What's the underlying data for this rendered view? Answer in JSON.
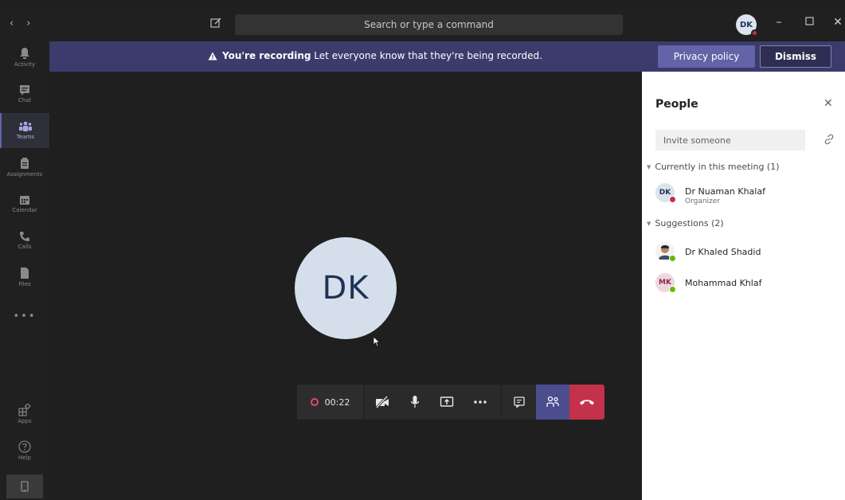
{
  "titlebar": {
    "search_placeholder": "Search or type a command",
    "avatar_initials": "DK",
    "back_arrow": "‹",
    "forward_arrow": "›"
  },
  "rail": {
    "items": [
      {
        "label": "Activity",
        "icon": "bell-icon"
      },
      {
        "label": "Chat",
        "icon": "chat-icon"
      },
      {
        "label": "Teams",
        "icon": "teams-icon"
      },
      {
        "label": "Assignments",
        "icon": "assignments-icon"
      },
      {
        "label": "Calendar",
        "icon": "calendar-icon"
      },
      {
        "label": "Calls",
        "icon": "phone-icon"
      },
      {
        "label": "Files",
        "icon": "file-icon"
      },
      {
        "label": "Apps",
        "icon": "apps-icon"
      },
      {
        "label": "Help",
        "icon": "help-icon"
      }
    ],
    "active": "Teams",
    "more": "•••"
  },
  "banner": {
    "title": "You're recording",
    "message": "Let everyone know that they're being recorded.",
    "privacy_label": "Privacy policy",
    "dismiss_label": "Dismiss"
  },
  "stage": {
    "avatar_initials": "DK"
  },
  "controls": {
    "recording_time": "00:22"
  },
  "people": {
    "title": "People",
    "invite_placeholder": "Invite someone",
    "in_meeting_label": "Currently in this meeting (1)",
    "in_meeting": [
      {
        "initials": "DK",
        "name": "Dr Nuaman Khalaf",
        "role": "Organizer",
        "status": "busy"
      }
    ],
    "suggestions_label": "Suggestions (2)",
    "suggestions": [
      {
        "initials": "",
        "name": "Dr Khaled Shadid",
        "status": "available"
      },
      {
        "initials": "MK",
        "name": "Mohammad Khlaf",
        "status": "available"
      }
    ]
  },
  "colors": {
    "accent": "#6264a7",
    "banner": "#3b3c6b",
    "hangup": "#c4314b",
    "available": "#6bb700",
    "busy": "#c4314b"
  }
}
